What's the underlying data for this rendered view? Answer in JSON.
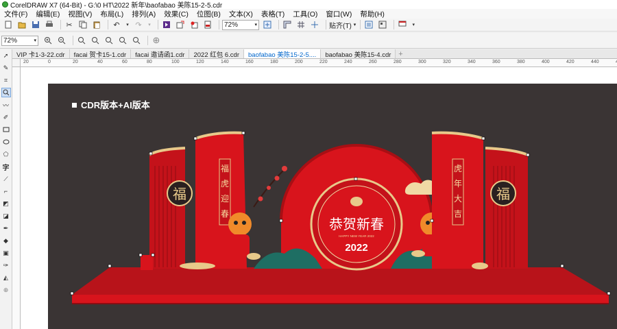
{
  "window": {
    "title": "CorelDRAW X7 (64-Bit) - G:\\0 HT\\2022 新年\\baofabao 美陈15-2-5.cdr"
  },
  "menu": [
    "文件(F)",
    "编辑(E)",
    "视图(V)",
    "布局(L)",
    "排列(A)",
    "效果(C)",
    "位图(B)",
    "文本(X)",
    "表格(T)",
    "工具(O)",
    "窗口(W)",
    "帮助(H)"
  ],
  "toolbar": {
    "zoom_value": "72%",
    "snap_label": "贴齐(T)"
  },
  "propbar": {
    "zoom_value": "72%"
  },
  "tabs": [
    {
      "label": "VIP 卡1-3-22.cdr",
      "active": false
    },
    {
      "label": "facai 贺卡15-1.cdr",
      "active": false
    },
    {
      "label": "facai 邀请函1.cdr",
      "active": false
    },
    {
      "label": "2022 红包 6.cdr",
      "active": false
    },
    {
      "label": "baofabao 美陈15-2-5....",
      "active": true
    },
    {
      "label": "baofabao 美陈15-4.cdr",
      "active": false
    }
  ],
  "ruler": {
    "h_ticks": [
      "20",
      "0",
      "20",
      "40",
      "60",
      "80",
      "100",
      "120",
      "140",
      "160",
      "180",
      "200",
      "220",
      "240",
      "260",
      "280",
      "300",
      "320",
      "340",
      "360",
      "380",
      "400",
      "420",
      "440",
      "460"
    ]
  },
  "design": {
    "heading": "CDR版本+AI版本",
    "left_roundel": "福",
    "right_roundel": "福",
    "left_banner": [
      "福",
      "虎",
      "迎",
      "春"
    ],
    "right_banner": [
      "虎",
      "年",
      "大",
      "吉"
    ],
    "center_title": "恭贺新春",
    "center_sub": "HAPPY NEW YEAR 2022",
    "center_year": "2022"
  },
  "colors": {
    "page_bg": "#3a3434",
    "red": "#d8141c",
    "dark_red": "#a80f14",
    "gold": "#e8c98a"
  }
}
